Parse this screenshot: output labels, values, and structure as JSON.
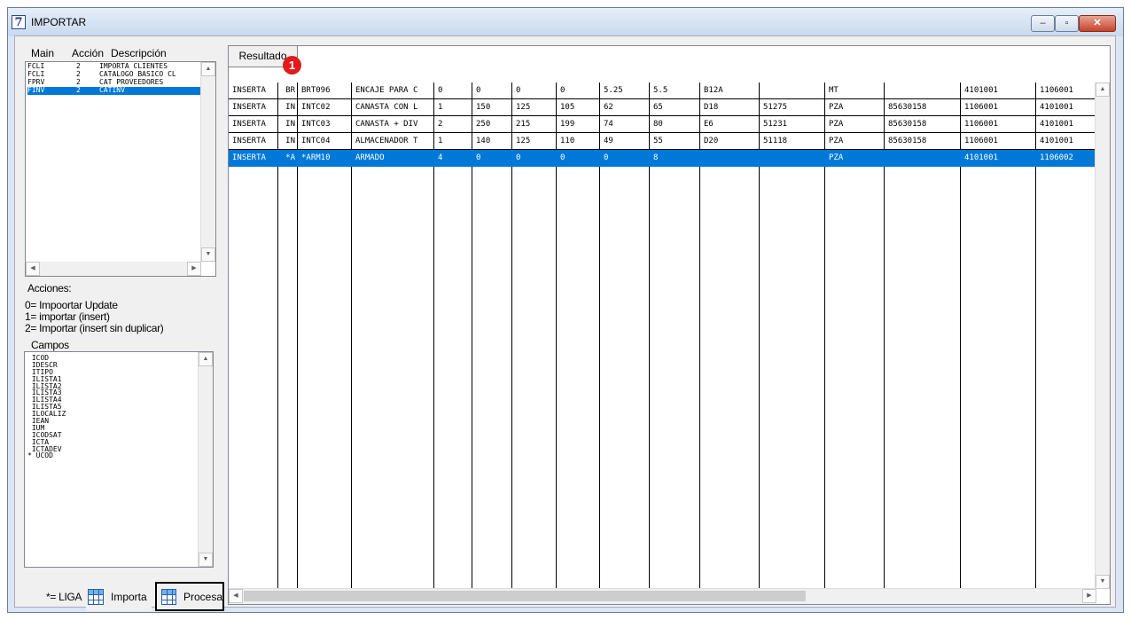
{
  "window": {
    "title": "IMPORTAR",
    "icon_glyph": "7"
  },
  "window_controls": {
    "minimize": "–",
    "maximize": "▫",
    "close": "✕"
  },
  "main_list": {
    "headers": {
      "main": "Main",
      "accion": "Acción",
      "descripcion": "Descripción"
    },
    "rows": [
      {
        "main": "FCLI",
        "accion": "2",
        "descripcion": "IMPORTA CLIENTES"
      },
      {
        "main": "FCLI",
        "accion": "2",
        "descripcion": "CATALOGO BASICO CL"
      },
      {
        "main": "FPRV",
        "accion": "2",
        "descripcion": "CAT PROVEEDORES"
      },
      {
        "main": "FINV",
        "accion": "2",
        "descripcion": "CATINV"
      }
    ],
    "selected_index": 3
  },
  "acciones": {
    "title": "Acciones:",
    "lines": [
      "0= Impoortar Update",
      "1= importar (insert)",
      "2= Importar (insert sin duplicar)"
    ]
  },
  "campos": {
    "title": "Campos",
    "items": [
      " ICOD",
      " IDESCR",
      " ITIPO",
      " ILISTA1",
      " ILISTA2",
      " ILISTA3",
      " ILISTA4",
      " ILISTA5",
      " ILOCALIZ",
      " IEAN",
      " IUM",
      " ICODSAT",
      " ICTA",
      " ICTADEV",
      "* UCOD"
    ]
  },
  "bottom": {
    "liga_label": "*= LIGA",
    "importa_label": "Importa",
    "procesa_label": "Procesa"
  },
  "result": {
    "tab_label": "Resultado",
    "badge": "1",
    "rows": [
      [
        "INSERTA",
        "BR",
        "BRT096",
        "ENCAJE PARA C",
        "0",
        "0",
        "0",
        "0",
        "5.25",
        "5.5",
        "B12A",
        "",
        "MT",
        "",
        "4101001",
        "1106001"
      ],
      [
        "INSERTA",
        "IN",
        "INTC02",
        "CANASTA CON L",
        "1",
        "150",
        "125",
        "105",
        "62",
        "65",
        "D18",
        "51275",
        "PZA",
        "85630158",
        "1106001",
        "4101001"
      ],
      [
        "INSERTA",
        "IN",
        "INTC03",
        "CANASTA + DIV",
        "2",
        "250",
        "215",
        "199",
        "74",
        "80",
        "E6",
        "51231",
        "PZA",
        "85630158",
        "1106001",
        "4101001"
      ],
      [
        "INSERTA",
        "IN",
        "INTC04",
        "ALMACENADOR T",
        "1",
        "140",
        "125",
        "110",
        "49",
        "55",
        "D20",
        "51118",
        "PZA",
        "85630158",
        "1106001",
        "4101001"
      ],
      [
        "INSERTA",
        "*A",
        "*ARM10",
        "ARMADO",
        "4",
        "0",
        "0",
        "0",
        "0",
        "8",
        "",
        "",
        "PZA",
        "",
        "4101001",
        "1106002"
      ]
    ],
    "selected_index": 4
  },
  "scroll_glyphs": {
    "up": "▲",
    "down": "▼",
    "left": "◀",
    "right": "▶"
  }
}
